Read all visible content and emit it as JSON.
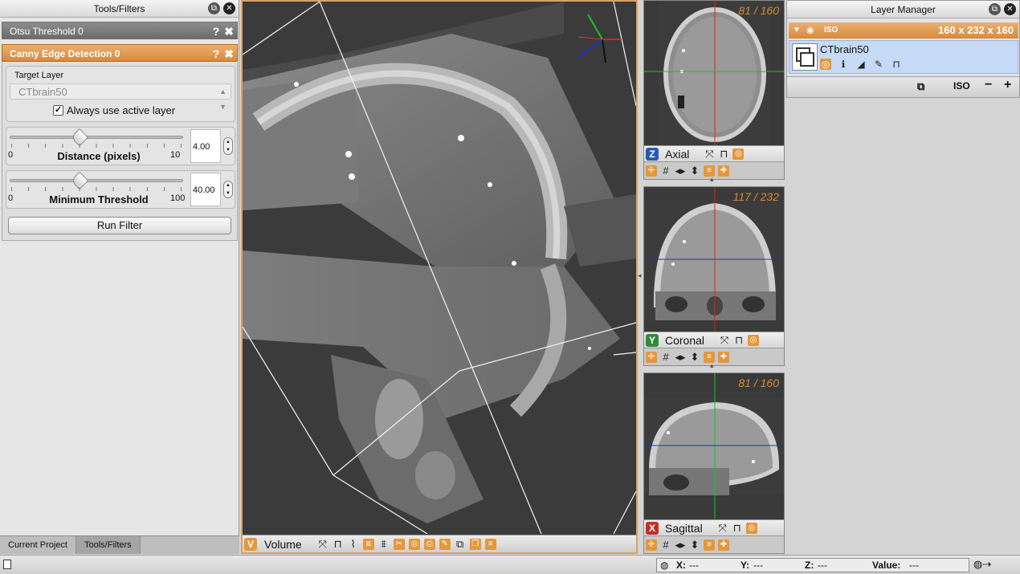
{
  "tools_panel": {
    "title": "Tools/Filters",
    "filters": [
      {
        "name": "Otsu Threshold 0"
      },
      {
        "name": "Canny Edge Detection 0"
      }
    ],
    "help_glyph": "?",
    "close_glyph": "✖",
    "target_layer": {
      "title": "Target Layer",
      "selected": "CTbrain50",
      "always_active_label": "Always use active layer",
      "always_active_checked": true
    },
    "distance": {
      "label": "Distance (pixels)",
      "min": "0",
      "max": "10",
      "value": "4.00",
      "fraction": 0.4
    },
    "threshold": {
      "label": "Minimum Threshold",
      "min": "0",
      "max": "100",
      "value": "40.00",
      "fraction": 0.4
    },
    "run_label": "Run Filter",
    "bottom_tabs": [
      "Current Project",
      "Tools/Filters"
    ],
    "active_tab": 1
  },
  "viewers": {
    "volume": {
      "key": "V",
      "name": "Volume",
      "key_color": "#e5973c"
    },
    "axial": {
      "key": "Z",
      "name": "Axial",
      "slice": "81 / 160",
      "key_color": "#2a58b0"
    },
    "coronal": {
      "key": "Y",
      "name": "Coronal",
      "slice": "117 / 232",
      "key_color": "#2f8a3a"
    },
    "sagittal": {
      "key": "X",
      "name": "Sagittal",
      "slice": "81 / 160",
      "key_color": "#c0302a"
    }
  },
  "layer_manager": {
    "title": "Layer Manager",
    "group_name": "ISO",
    "group_dims": "160 x 232 x 160",
    "layer_name": "CTbrain50",
    "bottom_iso_label": "ISO",
    "minus": "−",
    "plus": "+"
  },
  "status_bar": {
    "x_label": "X:",
    "x_value": "---",
    "y_label": "Y:",
    "y_value": "---",
    "z_label": "Z:",
    "z_value": "---",
    "value_label": "Value:",
    "value_value": "---"
  },
  "colors": {
    "accent": "#e5973c",
    "crosshair_red": "#e02020",
    "crosshair_green": "#20c020",
    "crosshair_blue": "#2030d0"
  }
}
